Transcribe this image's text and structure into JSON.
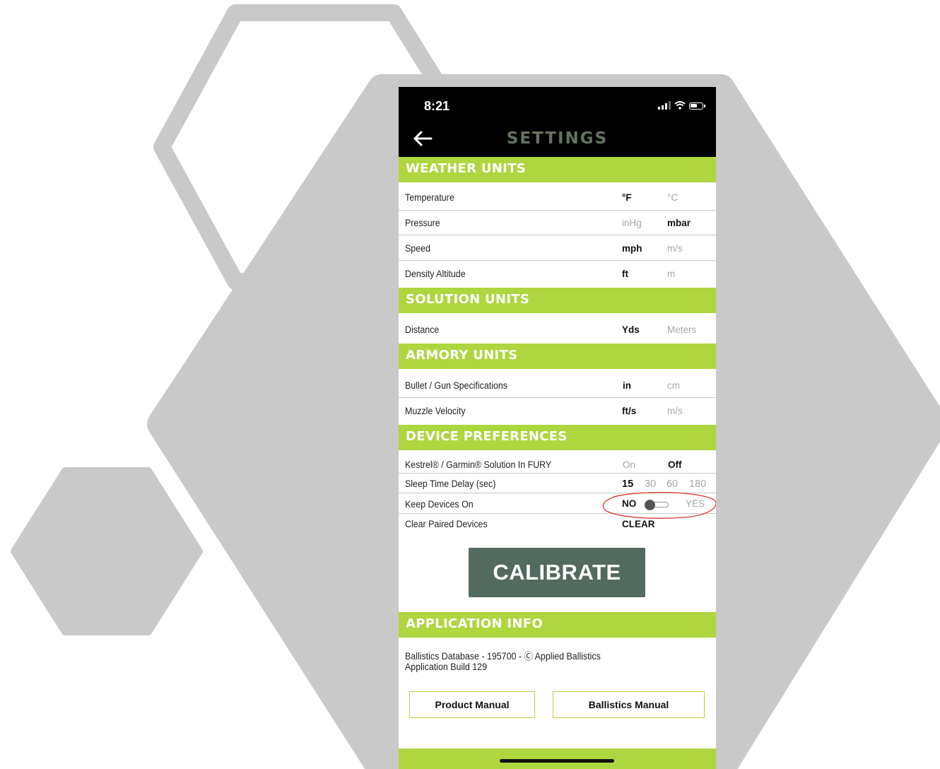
{
  "colors": {
    "accent": "#aed63e",
    "header_bg": "#000000",
    "button_bg": "#536a5e",
    "title": "#64735f"
  },
  "status_bar": {
    "time": "8:21",
    "icons": [
      "cellular-signal-icon",
      "wifi-icon",
      "battery-icon"
    ]
  },
  "header": {
    "title": "SETTINGS",
    "back_icon": "arrow-left-icon"
  },
  "weather": {
    "title": "WEATHER UNITS",
    "temperature": {
      "label": "Temperature",
      "a": "°F",
      "b": "°C",
      "selected": "°F"
    },
    "pressure": {
      "label": "Pressure",
      "a": "inHg",
      "b": "mbar",
      "selected": "mbar"
    },
    "speed": {
      "label": "Speed",
      "a": "mph",
      "b": "m/s",
      "selected": "mph"
    },
    "density": {
      "label": "Density Altitude",
      "a": "ft",
      "b": "m",
      "selected": "ft"
    }
  },
  "solution": {
    "title": "SOLUTION UNITS",
    "distance": {
      "label": "Distance",
      "a": "Yds",
      "b": "Meters",
      "selected": "Yds"
    }
  },
  "armory": {
    "title": "ARMORY UNITS",
    "bullet": {
      "label": "Bullet / Gun Specifications",
      "a": "in",
      "b": "cm",
      "selected": "in"
    },
    "muzzle": {
      "label": "Muzzle Velocity",
      "a": "ft/s",
      "b": "m/s",
      "selected": "ft/s"
    }
  },
  "device": {
    "title": "DEVICE PREFERENCES",
    "kestrel": {
      "label": "Kestrel® / Garmin® Solution In FURY",
      "a": "On",
      "b": "Off",
      "selected": "Off"
    },
    "sleep": {
      "label": "Sleep Time Delay (sec)",
      "options": [
        "15",
        "30",
        "60",
        "180"
      ],
      "selected": "15"
    },
    "keep_on": {
      "label": "Keep Devices On",
      "no": "NO",
      "yes": "YES",
      "value": false
    },
    "clear": {
      "label": "Clear Paired Devices",
      "action": "CLEAR"
    }
  },
  "calibrate_label": "CALIBRATE",
  "app_info": {
    "title": "APPLICATION INFO",
    "database": "Ballistics Database -  195700 - Ⓒ Applied Ballistics",
    "build": "Application Build 129"
  },
  "buttons": {
    "product_manual": "Product Manual",
    "ballistics_manual": "Ballistics Manual"
  }
}
